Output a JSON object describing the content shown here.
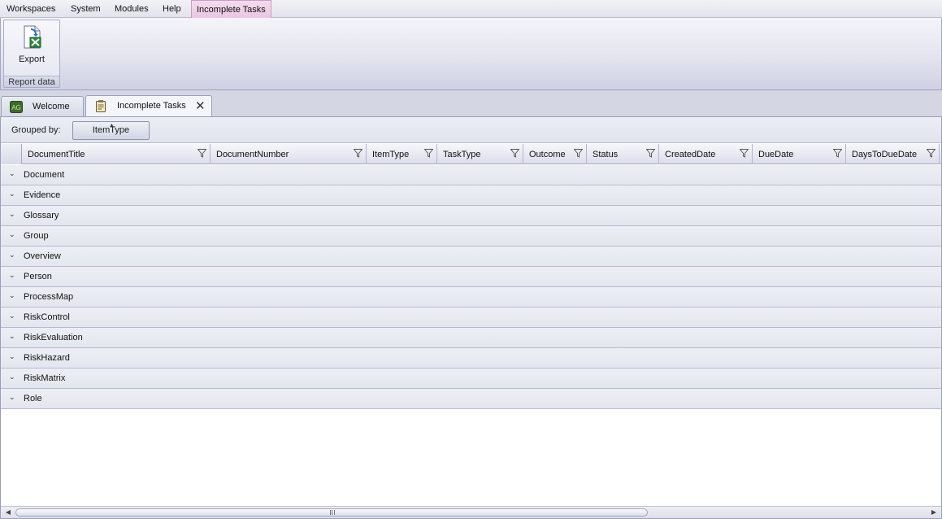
{
  "menu": {
    "items": [
      "Workspaces",
      "System",
      "Modules",
      "Help"
    ],
    "contextual_tab": "Incomplete Tasks"
  },
  "ribbon": {
    "export_label": "Export",
    "group_label": "Report data"
  },
  "tabs": [
    {
      "label": "Welcome",
      "icon": "app-logo-icon"
    },
    {
      "label": "Incomplete Tasks",
      "icon": "clipboard-icon",
      "close": "✕"
    }
  ],
  "grid": {
    "grouped_by_label": "Grouped by:",
    "group_chip": "ItemType",
    "columns": [
      "DocumentTitle",
      "DocumentNumber",
      "ItemType",
      "TaskType",
      "Outcome",
      "Status",
      "CreatedDate",
      "DueDate",
      "DaysToDueDate"
    ],
    "groups": [
      "Document",
      "Evidence",
      "Glossary",
      "Group",
      "Overview",
      "Person",
      "ProcessMap",
      "RiskControl",
      "RiskEvaluation",
      "RiskHazard",
      "RiskMatrix",
      "Role"
    ]
  },
  "colors": {
    "contextual_tab": "#e9c4e2",
    "chrome": "#d4d6e4"
  }
}
